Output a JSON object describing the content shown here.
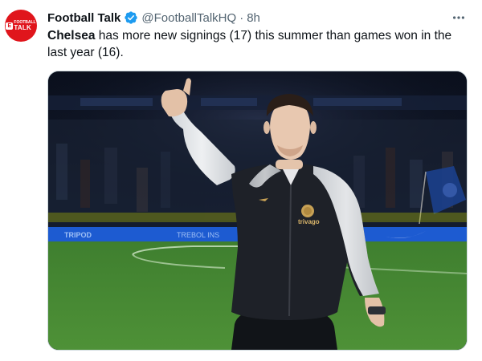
{
  "tweet": {
    "display_name": "Football Talk",
    "handle": "@FootballTalkHQ",
    "separator": "·",
    "time": "8h",
    "text_bold": "Chelsea",
    "text_rest": " has more new signings (17) this summer than games won in the last year (16).",
    "avatar": {
      "badge": "E",
      "line1": "FOOTBALL",
      "line2": "TALK"
    },
    "media": {
      "sponsor": "trivago",
      "banner_left": "TRIPOD",
      "banner_mid": "TREBOL INS"
    }
  },
  "colors": {
    "avatar_bg": "#e0151c",
    "verified": "#1d9bf0",
    "text_primary": "#0f1419",
    "text_secondary": "#536471"
  },
  "icons": {
    "verified": "verified-badge-icon",
    "more": "more-horizontal-icon"
  }
}
